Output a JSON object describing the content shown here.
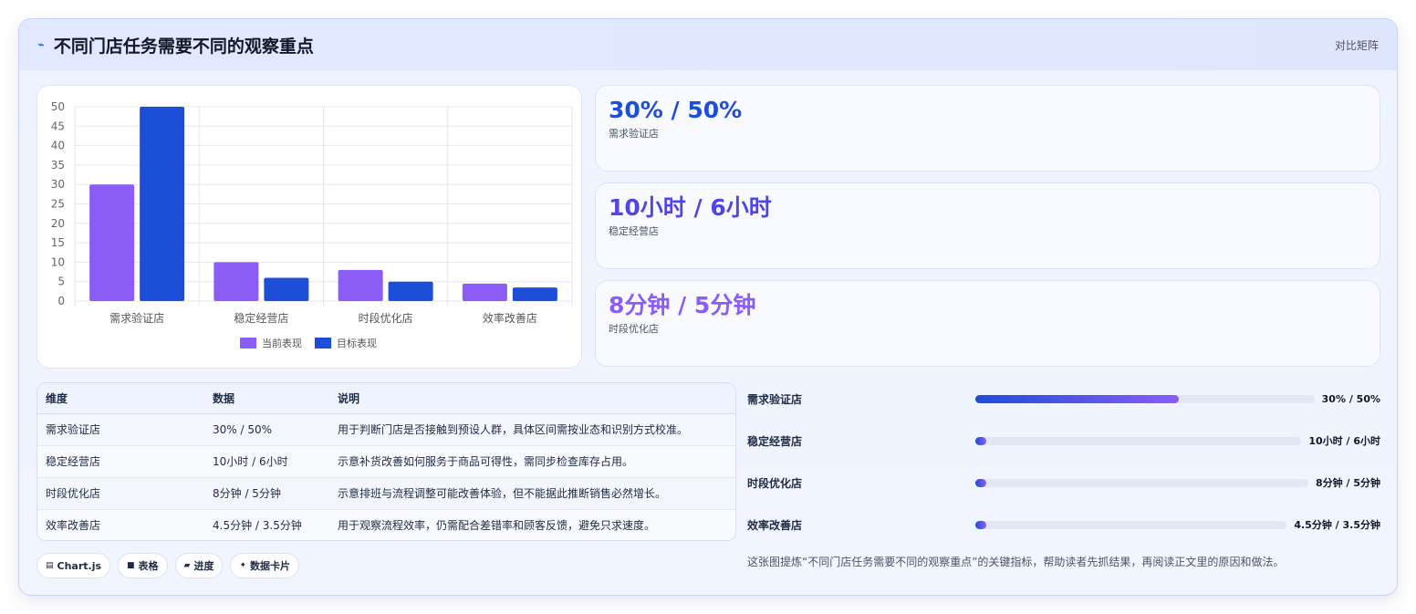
{
  "header": {
    "bolt_icon": "lightning-icon",
    "title": "不同门店任务需要不同的观察重点",
    "tag": "对比矩阵"
  },
  "colors": {
    "current": "#8b5cf6",
    "target": "#1d4ed8",
    "kpi1": "#1d4ed8",
    "kpi2": "#4f46e5",
    "kpi3": "#8b5cf6"
  },
  "chart_data": {
    "type": "bar",
    "categories": [
      "需求验证店",
      "稳定经营店",
      "时段优化店",
      "效率改善店"
    ],
    "series": [
      {
        "name": "当前表现",
        "values": [
          30,
          10,
          8,
          4.5
        ]
      },
      {
        "name": "目标表现",
        "values": [
          50,
          6,
          5,
          3.5
        ]
      }
    ],
    "ylim": [
      0,
      50
    ],
    "yticks": [
      0,
      5,
      10,
      15,
      20,
      25,
      30,
      35,
      40,
      45,
      50
    ],
    "grid": true,
    "legend": "bottom"
  },
  "kpis": [
    {
      "value": "30% / 50%",
      "label": "需求验证店"
    },
    {
      "value": "10小时 / 6小时",
      "label": "稳定经营店"
    },
    {
      "value": "8分钟 / 5分钟",
      "label": "时段优化店"
    }
  ],
  "table": {
    "headers": [
      "维度",
      "数据",
      "说明"
    ],
    "rows": [
      [
        "需求验证店",
        "30% / 50%",
        "用于判断门店是否接触到预设人群，具体区间需按业态和识别方式校准。"
      ],
      [
        "稳定经营店",
        "10小时 / 6小时",
        "示意补货改善如何服务于商品可得性，需同步检查库存占用。"
      ],
      [
        "时段优化店",
        "8分钟 / 5分钟",
        "示意排班与流程调整可能改善体验，但不能据此推断销售必然增长。"
      ],
      [
        "效率改善店",
        "4.5分钟 / 3.5分钟",
        "用于观察流程效率，仍需配合差错率和顾客反馈，避免只求速度。"
      ]
    ]
  },
  "chips": [
    {
      "icon": "chart-icon",
      "glyph": "▤",
      "label": "Chart.js"
    },
    {
      "icon": "table-icon",
      "glyph": "■",
      "label": "表格"
    },
    {
      "icon": "progress-icon",
      "glyph": "▰",
      "label": "进度"
    },
    {
      "icon": "sparkle-icon",
      "glyph": "✦",
      "label": "数据卡片"
    }
  ],
  "progress": [
    {
      "label": "需求验证店",
      "value": "30% / 50%",
      "fraction": 0.6
    },
    {
      "label": "稳定经营店",
      "value": "10小时 / 6小时",
      "fraction": 0.02
    },
    {
      "label": "时段优化店",
      "value": "8分钟 / 5分钟",
      "fraction": 0.02
    },
    {
      "label": "效率改善店",
      "value": "4.5分钟 / 3.5分钟",
      "fraction": 0.02
    }
  ],
  "note": "这张图提炼“不同门店任务需要不同的观察重点”的关键指标，帮助读者先抓结果，再阅读正文里的原因和做法。"
}
